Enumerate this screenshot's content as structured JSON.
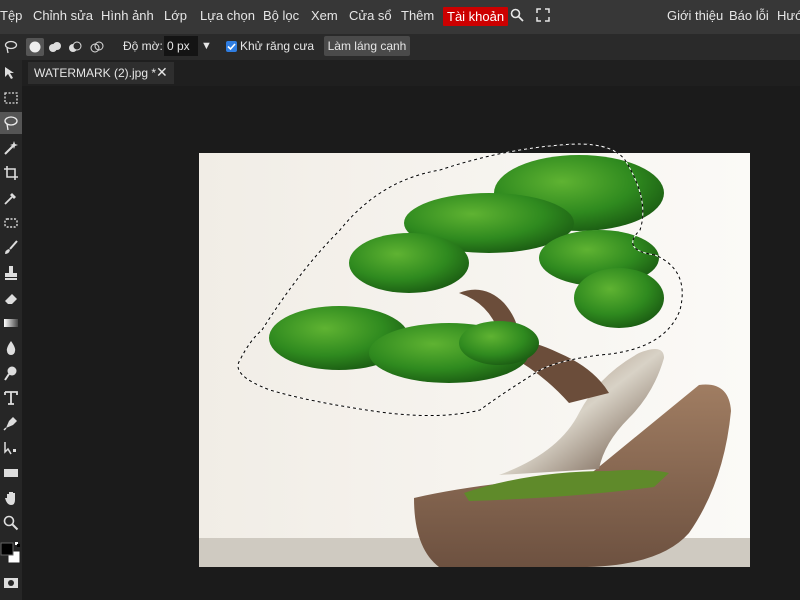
{
  "menubar": {
    "items": [
      "Tệp",
      "Chỉnh sửa",
      "Hình ảnh",
      "Lớp",
      "Lựa chọn",
      "Bộ lọc",
      "Xem",
      "Cửa sổ",
      "Thêm"
    ],
    "account": "Tài khoản",
    "right_items": [
      "Giới thiệu",
      "Báo lỗi",
      "Hướ"
    ]
  },
  "options": {
    "feather_label": "Độ mờ:",
    "feather_value": "0 px",
    "dropdown_arrow": "▼",
    "antialias_label": "Khử răng cưa",
    "antialias_checked": true,
    "smooth_button": "Làm láng cạnh"
  },
  "document": {
    "tab_title": "WATERMARK (2).jpg *",
    "close": "✕"
  },
  "colors": {
    "accent": "#cc0000",
    "checkbox": "#2f7de1",
    "foreground_swatch": "#000000",
    "background_swatch": "#ffffff"
  },
  "icons": {
    "toolbar": [
      "move-icon",
      "marquee-icon",
      "lasso-icon",
      "magic-wand-icon",
      "crop-icon",
      "eyedropper-icon",
      "healing-icon",
      "brush-icon",
      "stamp-icon",
      "eraser-icon",
      "gradient-icon",
      "blur-icon",
      "dodge-icon",
      "text-icon",
      "pen-icon",
      "path-select-icon",
      "rectangle-icon",
      "hand-icon",
      "zoom-icon"
    ]
  }
}
